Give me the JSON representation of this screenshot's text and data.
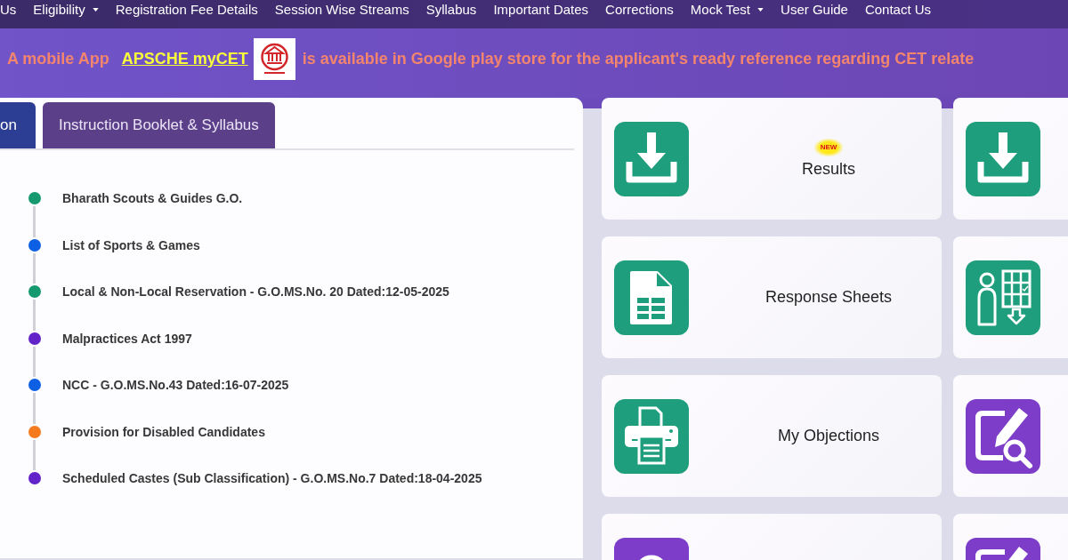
{
  "nav": {
    "items": [
      {
        "label": "Us",
        "dropdown": false
      },
      {
        "label": "Eligibility",
        "dropdown": true
      },
      {
        "label": "Registration Fee Details",
        "dropdown": false
      },
      {
        "label": "Session Wise Streams",
        "dropdown": false
      },
      {
        "label": "Syllabus",
        "dropdown": false
      },
      {
        "label": "Important Dates",
        "dropdown": false
      },
      {
        "label": "Corrections",
        "dropdown": false
      },
      {
        "label": "Mock Test",
        "dropdown": true
      },
      {
        "label": "User Guide",
        "dropdown": false
      },
      {
        "label": "Contact Us",
        "dropdown": false
      }
    ]
  },
  "announcement": {
    "lead": "A mobile App",
    "link": "APSCHE myCET",
    "rest": "is available in Google play store for the applicant's ready reference regarding CET relate"
  },
  "tabs": [
    {
      "label": "on",
      "selected": true
    },
    {
      "label": "Instruction Booklet & Syllabus",
      "selected": false
    }
  ],
  "documents": [
    {
      "title": "Bharath Scouts & Guides G.O.",
      "color": "#16996f"
    },
    {
      "title": "List of Sports & Games",
      "color": "#0d5fe3"
    },
    {
      "title": "Local & Non-Local Reservation - G.O.MS.No. 20 Dated:12-05-2025",
      "color": "#16996f"
    },
    {
      "title": "Malpractices Act 1997",
      "color": "#6223c9"
    },
    {
      "title": "NCC - G.O.MS.No.43 Dated:16-07-2025",
      "color": "#0d5fe3"
    },
    {
      "title": "Provision for Disabled Candidates",
      "color": "#f57a1e"
    },
    {
      "title": "Scheduled Castes (Sub Classification) - G.O.MS.No.7 Dated:18-04-2025",
      "color": "#6223c9"
    }
  ],
  "tiles": [
    {
      "kind": "download",
      "color": "#1e9e7c",
      "badge": "NEW",
      "label": "Results"
    },
    {
      "kind": "download",
      "color": "#1e9e7c"
    },
    {
      "kind": "sheet",
      "color": "#1e9e7c",
      "label": "Response Sheets"
    },
    {
      "kind": "person-grid",
      "color": "#1e9e7c"
    },
    {
      "kind": "printer",
      "color": "#1e9e7c",
      "label": "My Objections"
    },
    {
      "kind": "edit-search",
      "color": "#7d3dc8"
    },
    {
      "kind": "ring",
      "color": "#7d3dc8"
    },
    {
      "kind": "edit",
      "color": "#7d3dc8"
    }
  ]
}
